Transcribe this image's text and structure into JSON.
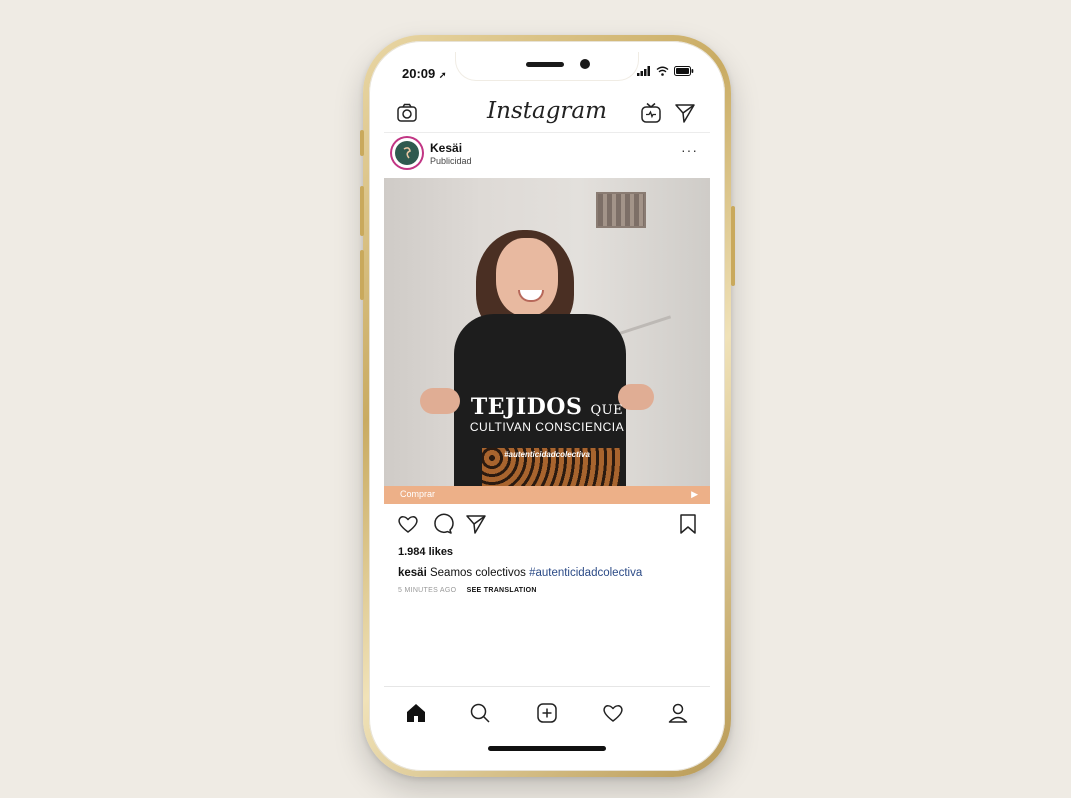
{
  "status_bar": {
    "time": "20:09",
    "icons": [
      "location-arrow-icon",
      "signal-icon",
      "wifi-icon",
      "battery-icon"
    ]
  },
  "header": {
    "logo": "Instagram",
    "icons": [
      "camera-icon",
      "igtv-icon",
      "direct-icon"
    ]
  },
  "post": {
    "username": "Kesäi",
    "sponsored_label": "Publicidad",
    "more_label": "···",
    "overlay_title_main": "TEJIDOS",
    "overlay_title_small": "QUE",
    "overlay_subtitle": "CULTIVAN CONSCIENCIA",
    "overlay_tag": "#autenticidadcolectiva",
    "cta_label": "Comprar",
    "cta_arrow": "▶",
    "likes": "1.984 likes",
    "caption_user": "kesäi",
    "caption_text": "Seamos colectivos",
    "caption_hashtag": "#autenticidadcolectiva",
    "time_ago": "5 MINUTES AGO",
    "see_translation": "SEE TRANSLATION"
  },
  "tab_bar": {
    "items": [
      "home-icon",
      "search-icon",
      "add-post-icon",
      "activity-heart-icon",
      "profile-icon"
    ]
  },
  "colors": {
    "background": "#efebe4",
    "phone_frame": "#c9ab62",
    "cta_bar": "#edb088",
    "hashtag": "#2b4a86"
  }
}
